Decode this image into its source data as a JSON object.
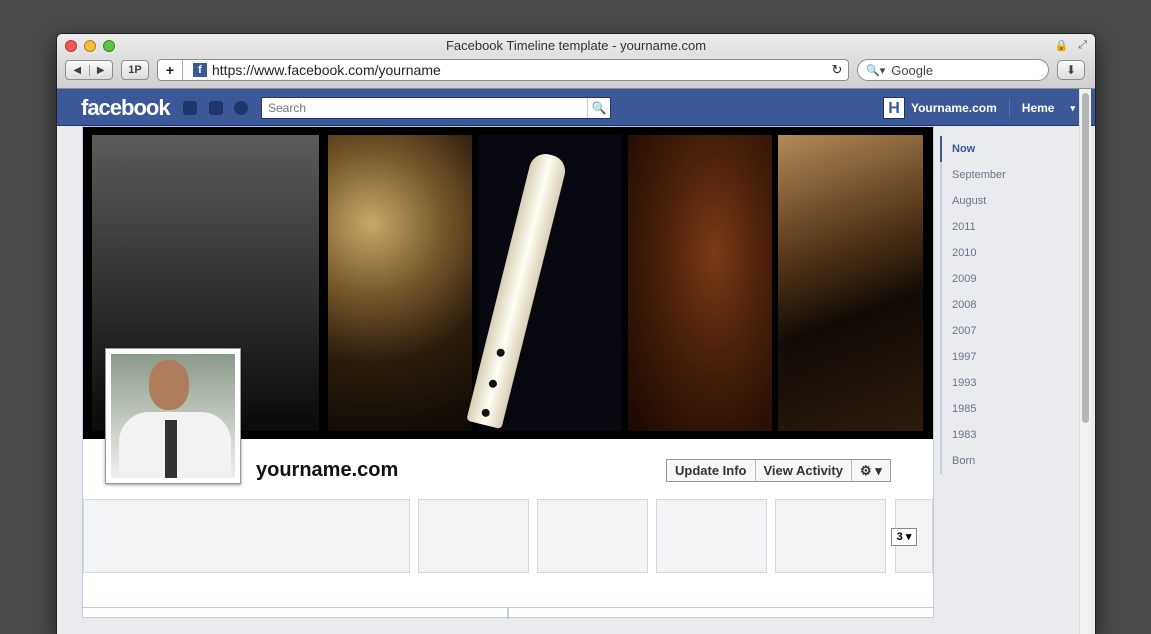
{
  "window": {
    "title": "Facebook Timeline template - yourname.com"
  },
  "toolbar": {
    "back": "◀",
    "forward": "▶",
    "onep": "1P",
    "add": "+",
    "url": "https://www.facebook.com/yourname",
    "reload": "↻",
    "search_placeholder": "Google",
    "download": "⬇"
  },
  "fb": {
    "logo": "facebook",
    "search_placeholder": "Search",
    "search_icon": "🔍",
    "user_initial": "H",
    "user_name": "Yourname.com",
    "home": "Heme",
    "caret": "▾",
    "favicon": "f"
  },
  "profile": {
    "name": "yourname.com",
    "update_info": "Update Info",
    "view_activity": "View Activity",
    "gear": "⚙ ▾",
    "tile_more": "3 ▾"
  },
  "scrubber": {
    "items": [
      "Now",
      "September",
      "August",
      "2011",
      "2010",
      "2009",
      "2008",
      "2007",
      "1997",
      "1993",
      "1985",
      "1983",
      "Born"
    ]
  }
}
